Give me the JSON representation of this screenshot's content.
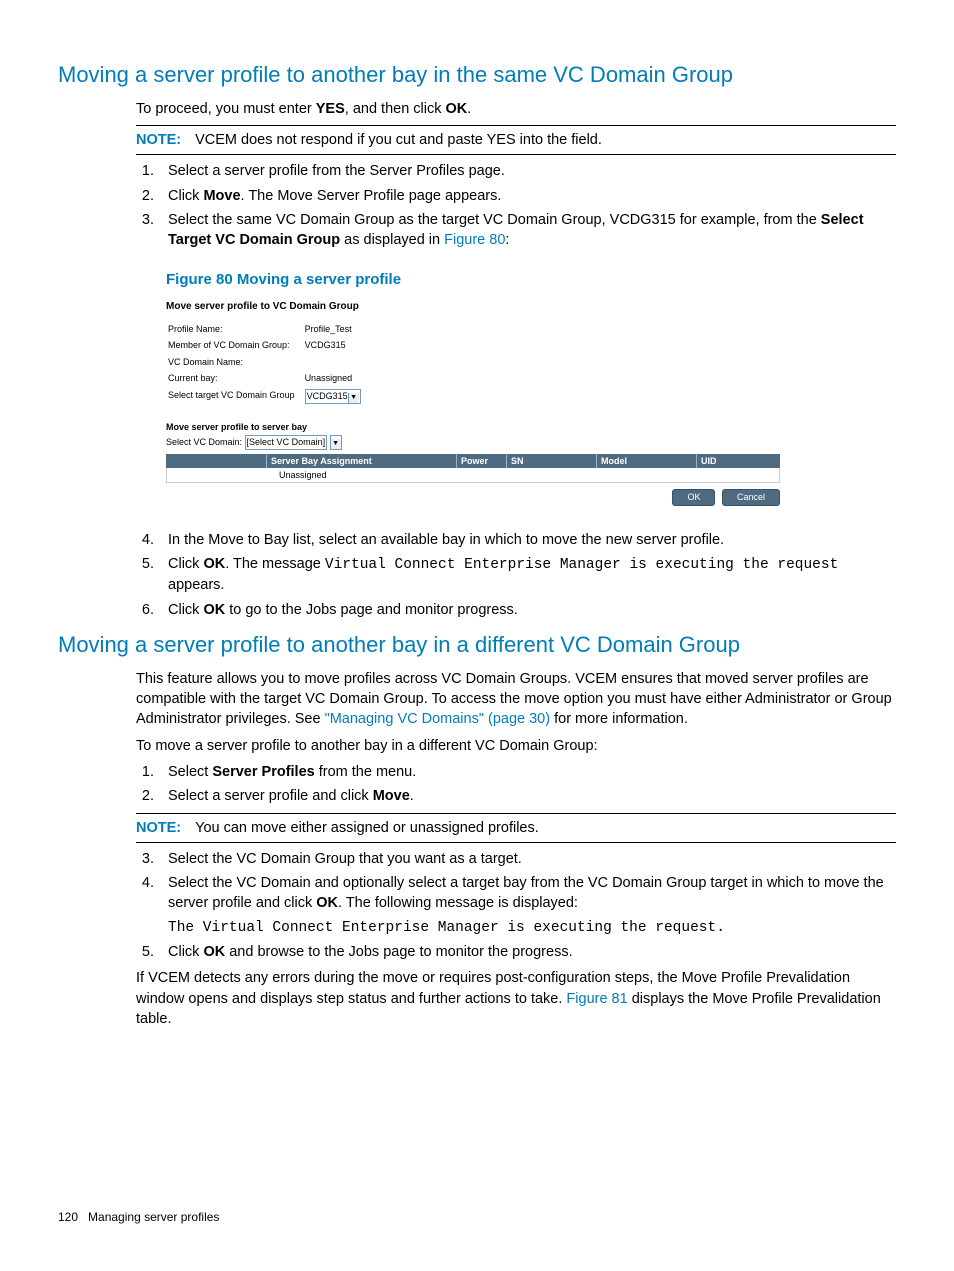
{
  "section1": {
    "heading": "Moving a server profile to another bay in the same VC Domain Group",
    "intro_pre": "To proceed, you must enter ",
    "intro_yes": "YES",
    "intro_mid": ", and then click ",
    "intro_ok": "OK",
    "intro_post": ".",
    "note_label": "NOTE:",
    "note_text": "VCEM does not respond if you cut and paste YES into the field.",
    "step1": "Select a server profile from the Server Profiles page.",
    "step2_pre": "Click ",
    "step2_move": "Move",
    "step2_post": ". The Move Server Profile page appears.",
    "step3_pre": "Select the same VC Domain Group as the target VC Domain Group, VCDG315 for example, from the ",
    "step3_bold": "Select Target VC Domain Group",
    "step3_mid": " as displayed in ",
    "step3_link": "Figure 80",
    "step3_post": ":",
    "figure_caption": "Figure 80 Moving a server profile",
    "step4": "In the Move to Bay list, select an available bay in which to move the new server profile.",
    "step5_pre": "Click ",
    "step5_ok": "OK",
    "step5_mid": ". The message ",
    "step5_msg": "Virtual Connect Enterprise Manager is executing the request",
    "step5_post": " appears.",
    "step6_pre": "Click ",
    "step6_ok": "OK",
    "step6_post": " to go to the Jobs page and monitor progress."
  },
  "figure80": {
    "title": "Move server profile to VC Domain Group",
    "rows": {
      "profile_name_k": "Profile Name:",
      "profile_name_v": "Profile_Test",
      "member_k": "Member of VC Domain Group:",
      "member_v": "VCDG315",
      "vc_domain_name_k": "VC Domain Name:",
      "vc_domain_name_v": "",
      "current_bay_k": "Current bay:",
      "current_bay_v": "Unassigned",
      "select_target_k": "Select target VC Domain Group",
      "select_target_v": "VCDG315"
    },
    "sub_title": "Move server profile to server bay",
    "select_vc_domain_k": "Select VC Domain:",
    "select_vc_domain_v": "[Select VC Domain]",
    "cols": {
      "c1": "Server Bay Assignment",
      "c2": "Power",
      "c3": "SN",
      "c4": "Model",
      "c5": "UID"
    },
    "body_c1": "Unassigned",
    "ok": "OK",
    "cancel": "Cancel"
  },
  "section2": {
    "heading": "Moving a server profile to another bay in a different VC Domain Group",
    "p1_pre": "This feature allows you to move profiles across VC Domain Groups. VCEM ensures that moved server profiles are compatible with the target VC Domain Group. To access the move option you must have either Administrator or Group Administrator privileges. See ",
    "p1_link": "\"Managing VC Domains\" (page 30)",
    "p1_post": " for more information.",
    "p2": "To move a server profile to another bay in a different VC Domain Group:",
    "step1_pre": "Select ",
    "step1_bold": "Server Profiles",
    "step1_post": " from the menu.",
    "step2_pre": "Select a server profile and click ",
    "step2_bold": "Move",
    "step2_post": ".",
    "note_label": "NOTE:",
    "note_text": "You can move either assigned or unassigned profiles.",
    "step3": "Select the VC Domain Group that you want as a target.",
    "step4_pre": "Select the VC Domain and optionally select a target bay from the VC Domain Group target in which to move the server profile and click ",
    "step4_bold": "OK",
    "step4_post": ". The following message is displayed:",
    "step4_msg": "The Virtual Connect Enterprise Manager is executing the request.",
    "step5_pre": "Click ",
    "step5_bold": "OK",
    "step5_post": " and browse to the Jobs page to monitor the progress.",
    "p3_pre": "If VCEM detects any errors during the move or requires post-configuration steps, the Move Profile Prevalidation window opens and displays step status and further actions to take. ",
    "p3_link": "Figure 81",
    "p3_post": " displays the Move Profile Prevalidation table."
  },
  "footer": {
    "page_number": "120",
    "section_name": "Managing server profiles"
  }
}
